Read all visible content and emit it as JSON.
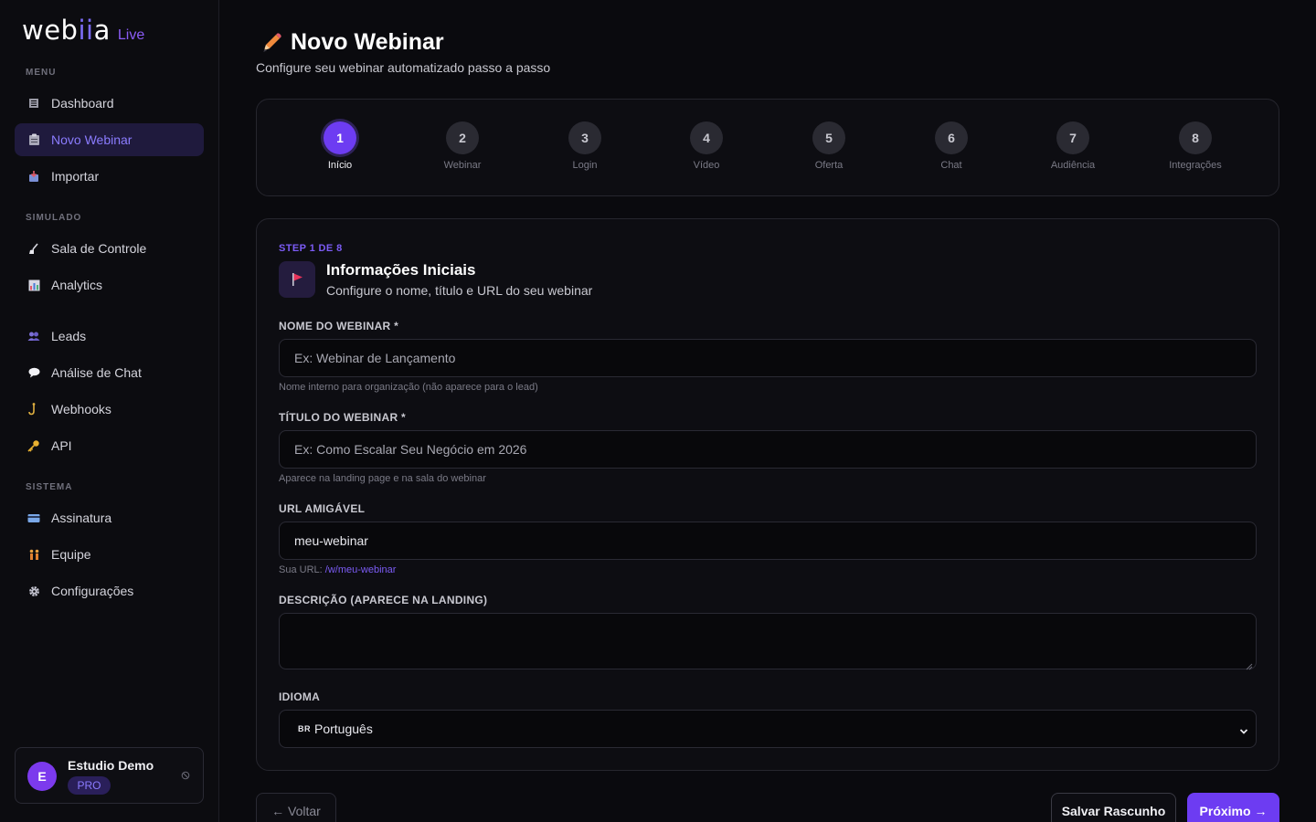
{
  "brand": {
    "name_prefix": "web",
    "name_accent": "ii",
    "name_suffix": "a",
    "badge": "Live",
    "accent_color": "#8b5cf6"
  },
  "sidebar": {
    "sections": [
      {
        "label": "MENU",
        "items": [
          {
            "label": "Dashboard",
            "icon": "dashboard-icon"
          },
          {
            "label": "Novo Webinar",
            "icon": "clipboard-icon",
            "active": true
          },
          {
            "label": "Importar",
            "icon": "import-icon"
          }
        ]
      },
      {
        "label": "SIMULADO",
        "items": [
          {
            "label": "Sala de Controle",
            "icon": "broom-icon"
          },
          {
            "label": "Analytics",
            "icon": "chart-icon"
          },
          {
            "label": "Leads",
            "icon": "users-icon"
          },
          {
            "label": "Análise de Chat",
            "icon": "chat-bubble-icon"
          },
          {
            "label": "Webhooks",
            "icon": "hook-icon"
          },
          {
            "label": "API",
            "icon": "key-icon"
          }
        ]
      },
      {
        "label": "SISTEMA",
        "items": [
          {
            "label": "Assinatura",
            "icon": "credit-card-icon"
          },
          {
            "label": "Equipe",
            "icon": "team-icon"
          },
          {
            "label": "Configurações",
            "icon": "gear-icon"
          }
        ]
      }
    ],
    "user": {
      "initial": "E",
      "name": "Estudio Demo",
      "plan": "PRO"
    }
  },
  "page": {
    "title": "Novo Webinar",
    "subtitle": "Configure seu webinar automatizado passo a passo"
  },
  "stepper": {
    "steps": [
      {
        "number": "1",
        "label": "Início",
        "active": true
      },
      {
        "number": "2",
        "label": "Webinar"
      },
      {
        "number": "3",
        "label": "Login"
      },
      {
        "number": "4",
        "label": "Vídeo"
      },
      {
        "number": "5",
        "label": "Oferta"
      },
      {
        "number": "6",
        "label": "Chat"
      },
      {
        "number": "7",
        "label": "Audiência"
      },
      {
        "number": "8",
        "label": "Integrações"
      }
    ]
  },
  "form": {
    "step_counter": "STEP 1 DE 8",
    "section_title": "Informações Iniciais",
    "section_desc": "Configure o nome, título e URL do seu webinar",
    "fields": {
      "name": {
        "label": "NOME DO WEBINAR *",
        "placeholder": "Ex: Webinar de Lançamento",
        "hint": "Nome interno para organização (não aparece para o lead)"
      },
      "title": {
        "label": "TÍTULO DO WEBINAR *",
        "placeholder": "Ex: Como Escalar Seu Negócio em 2026",
        "hint": "Aparece na landing page e na sala do webinar"
      },
      "url": {
        "label": "URL AMIGÁVEL",
        "value": "meu-webinar",
        "hint_prefix": "Sua URL:",
        "hint_link": "/w/meu-webinar"
      },
      "description": {
        "label": "DESCRIÇÃO (APARECE NA LANDING)",
        "value": ""
      },
      "language": {
        "label": "IDIOMA",
        "flag": "BR",
        "value": "Português"
      }
    }
  },
  "actions": {
    "back": "← Voltar",
    "save_draft": "Salvar Rascunho",
    "next": "Próximo →"
  }
}
